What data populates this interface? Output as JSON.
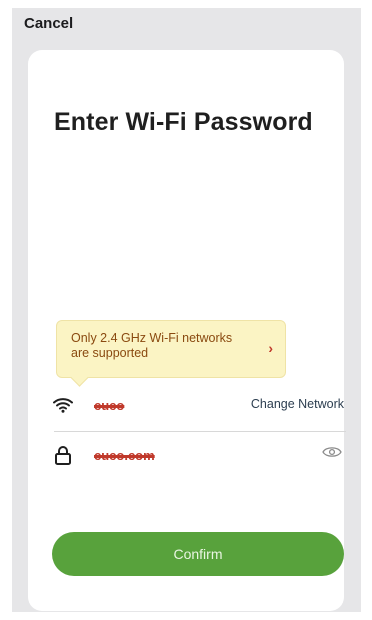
{
  "header": {
    "cancel_label": "Cancel"
  },
  "sheet": {
    "title": "Enter Wi-Fi Password",
    "tooltip": {
      "line1": "Only 2.4 GHz Wi-Fi networks",
      "line2": "are supported",
      "chevron": "›"
    },
    "network": {
      "ssid": "cuco",
      "change_label": "Change Network",
      "icon": "wifi-icon"
    },
    "password": {
      "value": "cuco.com",
      "icon": "lock-icon",
      "toggle_icon": "eye-icon"
    },
    "confirm_label": "Confirm"
  },
  "colors": {
    "accent_green": "#58a23c",
    "tooltip_bg": "#fbf4c4",
    "tooltip_text": "#8a4a10",
    "redaction": "#c0392b"
  }
}
